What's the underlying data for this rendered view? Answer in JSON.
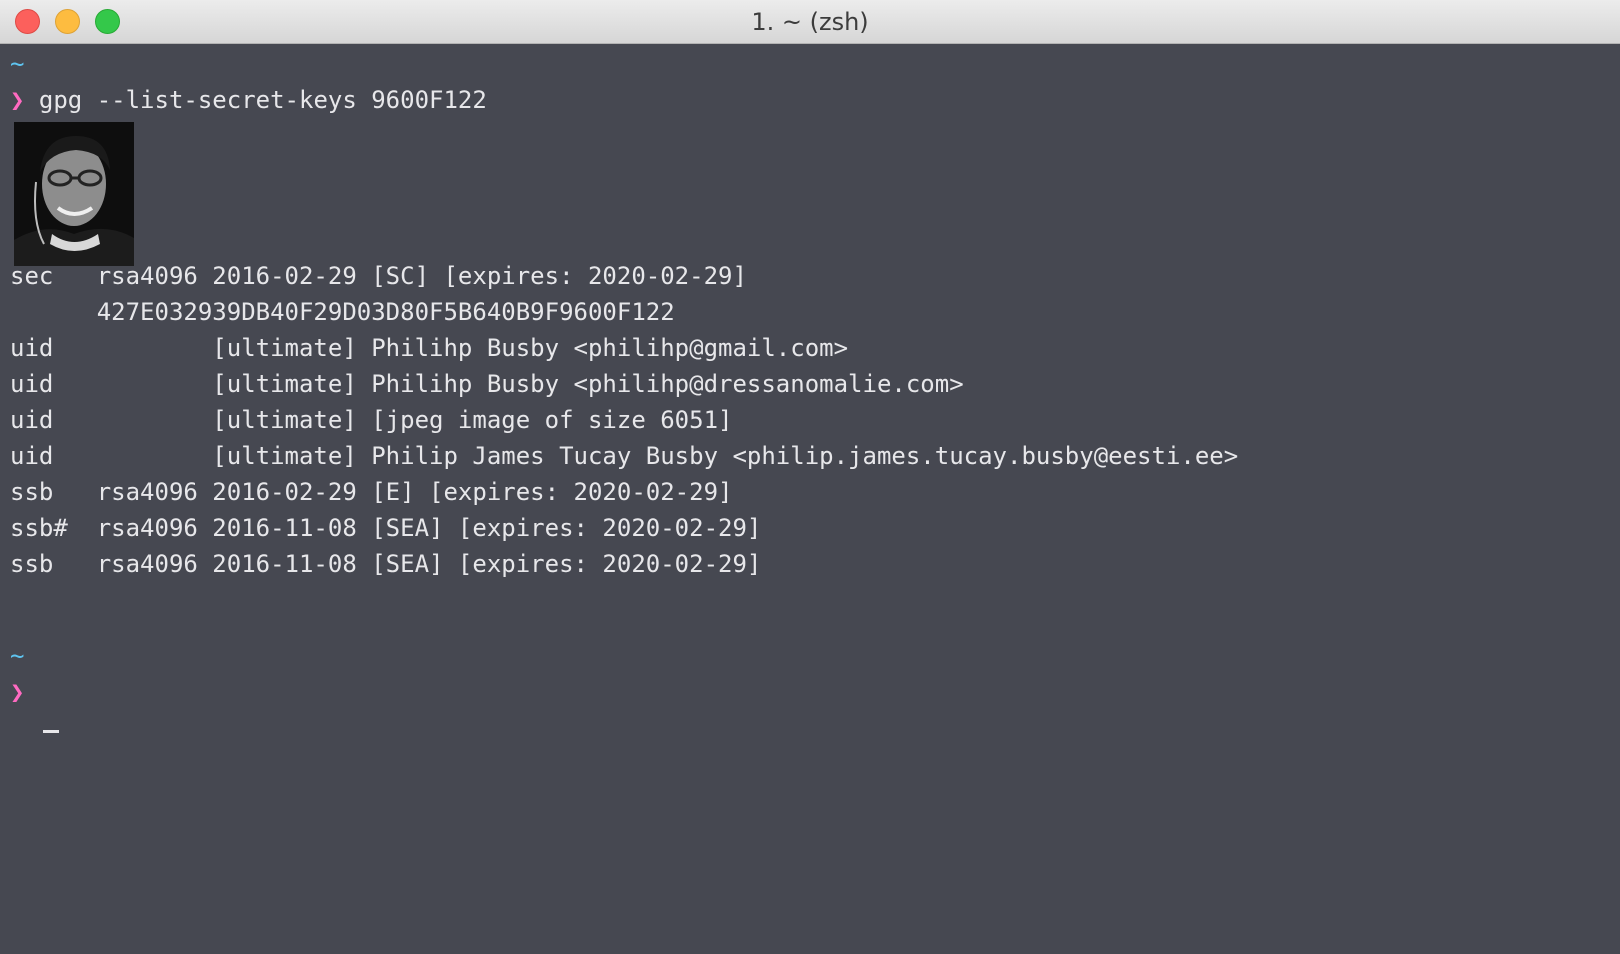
{
  "window": {
    "title": "1. ~ (zsh)"
  },
  "terminal": {
    "tilde_1": "~",
    "prompt_symbol": "❯",
    "command": " gpg --list-secret-keys 9600F122",
    "photo_icon": "user-photo",
    "lines": [
      "sec   rsa4096 2016-02-29 [SC] [expires: 2020-02-29]",
      "      427E032939DB40F29D03D80F5B640B9F9600F122",
      "uid           [ultimate] Philihp Busby <philihp@gmail.com>",
      "uid           [ultimate] Philihp Busby <philihp@dressanomalie.com>",
      "uid           [ultimate] [jpeg image of size 6051]",
      "uid           [ultimate] Philip James Tucay Busby <philip.james.tucay.busby@eesti.ee>",
      "ssb   rsa4096 2016-02-29 [E] [expires: 2020-02-29]",
      "ssb#  rsa4096 2016-11-08 [SEA] [expires: 2020-02-29]",
      "ssb   rsa4096 2016-11-08 [SEA] [expires: 2020-02-29]"
    ],
    "tilde_2": "~",
    "prompt_symbol_2": "❯"
  },
  "colors": {
    "background": "#464851",
    "tilde": "#5ec4f0",
    "prompt": "#ff6ac1",
    "text": "#e7e7ea"
  }
}
